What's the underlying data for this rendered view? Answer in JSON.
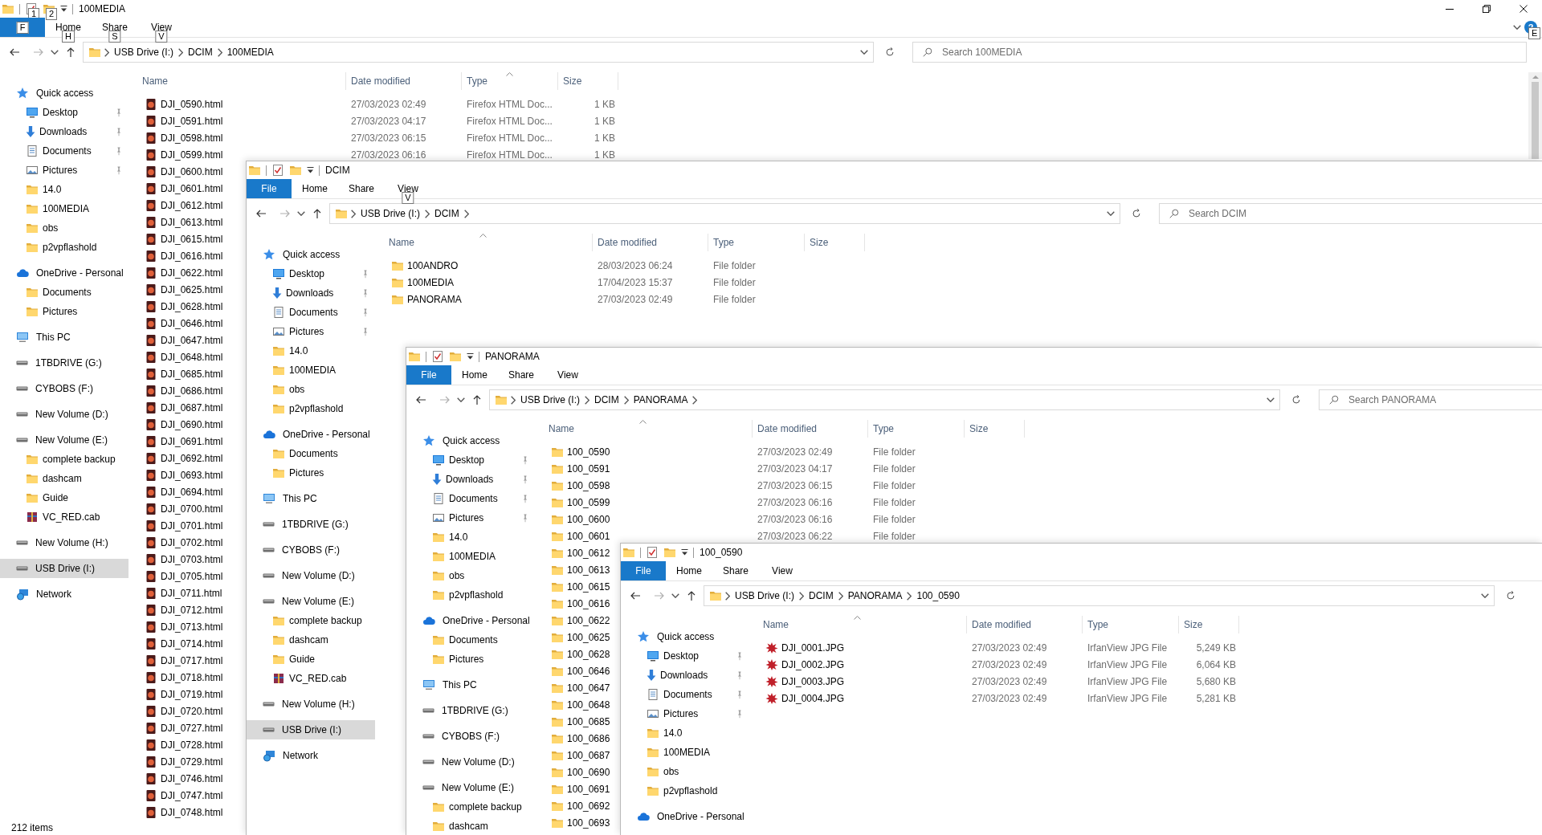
{
  "windows": [
    {
      "title": "100MEDIA",
      "window_buttons": true,
      "qat_keytips": [
        "1",
        "2"
      ],
      "help": "?",
      "help_keytip": "E",
      "tabs": [
        {
          "kind": "file",
          "keytip": "F"
        },
        {
          "kind": "tab",
          "label": "Home",
          "keytip": "H"
        },
        {
          "kind": "tab",
          "label": "Share",
          "keytip": "S"
        },
        {
          "kind": "tab",
          "label": "View",
          "keytip": "V"
        }
      ],
      "path": [
        "USB Drive (I:)",
        "DCIM",
        "100MEDIA"
      ],
      "search": {
        "placeholder": "Search 100MEDIA"
      },
      "columns": [
        {
          "label": "Name",
          "sorted": false
        },
        {
          "label": "Date modified",
          "sorted": false
        },
        {
          "label": "Type",
          "sorted": true
        },
        {
          "label": "Size",
          "sorted": false
        }
      ],
      "nav": [
        {
          "label": "Quick access",
          "kind": "star",
          "selected": false,
          "children": [
            {
              "label": "Desktop",
              "kind": "desktop",
              "pinned": true,
              "selected": false
            },
            {
              "label": "Downloads",
              "kind": "downloads",
              "pinned": true,
              "selected": false
            },
            {
              "label": "Documents",
              "kind": "documents",
              "pinned": true,
              "selected": false
            },
            {
              "label": "Pictures",
              "kind": "pictures",
              "pinned": true,
              "selected": false
            },
            {
              "label": "14.0",
              "kind": "folder",
              "pinned": false,
              "selected": false
            },
            {
              "label": "100MEDIA",
              "kind": "folder",
              "pinned": false,
              "selected": false
            },
            {
              "label": "obs",
              "kind": "folder",
              "pinned": false,
              "selected": false
            },
            {
              "label": "p2vpflashold",
              "kind": "folder",
              "pinned": false,
              "selected": false
            }
          ]
        },
        {
          "label": "OneDrive - Personal",
          "kind": "cloud",
          "selected": false,
          "children": [
            {
              "label": "Documents",
              "kind": "folder",
              "selected": false
            },
            {
              "label": "Pictures",
              "kind": "folder",
              "selected": false
            }
          ]
        },
        {
          "label": "This PC",
          "kind": "pc",
          "selected": false
        },
        {
          "label": "1TBDRIVE (G:)",
          "kind": "drive",
          "selected": false
        },
        {
          "label": "CYBOBS (F:)",
          "kind": "drive",
          "selected": false
        },
        {
          "label": "New Volume (D:)",
          "kind": "drive",
          "selected": false
        },
        {
          "label": "New Volume (E:)",
          "kind": "drive",
          "selected": false,
          "children": [
            {
              "label": "complete backup",
              "kind": "folder",
              "selected": false
            },
            {
              "label": "dashcam",
              "kind": "folder",
              "selected": false
            },
            {
              "label": "Guide",
              "kind": "folder",
              "selected": false
            },
            {
              "label": "VC_RED.cab",
              "kind": "cab",
              "selected": false
            }
          ]
        },
        {
          "label": "New Volume (H:)",
          "kind": "drive",
          "selected": false
        },
        {
          "label": "USB Drive (I:)",
          "kind": "drive",
          "selected": true
        },
        {
          "label": "Network",
          "kind": "network",
          "selected": false
        }
      ],
      "rows": [
        {
          "kind": "html",
          "name": "DJI_0590.html",
          "date": "27/03/2023 02:49",
          "type": "Firefox HTML Doc...",
          "size": "1 KB"
        },
        {
          "kind": "html",
          "name": "DJI_0591.html",
          "date": "27/03/2023 04:17",
          "type": "Firefox HTML Doc...",
          "size": "1 KB"
        },
        {
          "kind": "html",
          "name": "DJI_0598.html",
          "date": "27/03/2023 06:15",
          "type": "Firefox HTML Doc...",
          "size": "1 KB"
        },
        {
          "kind": "html",
          "name": "DJI_0599.html",
          "date": "27/03/2023 06:16",
          "type": "Firefox HTML Doc...",
          "size": "1 KB"
        },
        {
          "kind": "html",
          "name": "DJI_0600.html"
        },
        {
          "kind": "html",
          "name": "DJI_0601.html"
        },
        {
          "kind": "html",
          "name": "DJI_0612.html"
        },
        {
          "kind": "html",
          "name": "DJI_0613.html"
        },
        {
          "kind": "html",
          "name": "DJI_0615.html"
        },
        {
          "kind": "html",
          "name": "DJI_0616.html"
        },
        {
          "kind": "html",
          "name": "DJI_0622.html"
        },
        {
          "kind": "html",
          "name": "DJI_0625.html"
        },
        {
          "kind": "html",
          "name": "DJI_0628.html"
        },
        {
          "kind": "html",
          "name": "DJI_0646.html"
        },
        {
          "kind": "html",
          "name": "DJI_0647.html"
        },
        {
          "kind": "html",
          "name": "DJI_0648.html"
        },
        {
          "kind": "html",
          "name": "DJI_0685.html"
        },
        {
          "kind": "html",
          "name": "DJI_0686.html"
        },
        {
          "kind": "html",
          "name": "DJI_0687.html"
        },
        {
          "kind": "html",
          "name": "DJI_0690.html"
        },
        {
          "kind": "html",
          "name": "DJI_0691.html"
        },
        {
          "kind": "html",
          "name": "DJI_0692.html"
        },
        {
          "kind": "html",
          "name": "DJI_0693.html"
        },
        {
          "kind": "html",
          "name": "DJI_0694.html"
        },
        {
          "kind": "html",
          "name": "DJI_0700.html"
        },
        {
          "kind": "html",
          "name": "DJI_0701.html"
        },
        {
          "kind": "html",
          "name": "DJI_0702.html"
        },
        {
          "kind": "html",
          "name": "DJI_0703.html"
        },
        {
          "kind": "html",
          "name": "DJI_0705.html"
        },
        {
          "kind": "html",
          "name": "DJI_0711.html"
        },
        {
          "kind": "html",
          "name": "DJI_0712.html"
        },
        {
          "kind": "html",
          "name": "DJI_0713.html"
        },
        {
          "kind": "html",
          "name": "DJI_0714.html"
        },
        {
          "kind": "html",
          "name": "DJI_0717.html"
        },
        {
          "kind": "html",
          "name": "DJI_0718.html"
        },
        {
          "kind": "html",
          "name": "DJI_0719.html"
        },
        {
          "kind": "html",
          "name": "DJI_0720.html"
        },
        {
          "kind": "html",
          "name": "DJI_0727.html"
        },
        {
          "kind": "html",
          "name": "DJI_0728.html"
        },
        {
          "kind": "html",
          "name": "DJI_0729.html"
        },
        {
          "kind": "html",
          "name": "DJI_0746.html"
        },
        {
          "kind": "html",
          "name": "DJI_0747.html"
        },
        {
          "kind": "html",
          "name": "DJI_0748.html"
        }
      ],
      "status": "212 items"
    },
    {
      "title": "DCIM",
      "tabs": [
        {
          "kind": "file",
          "label": "File"
        },
        {
          "kind": "tab",
          "label": "Home"
        },
        {
          "kind": "tab",
          "label": "Share"
        },
        {
          "kind": "tab",
          "label": "View",
          "keytip": "V"
        }
      ],
      "path": [
        "USB Drive (I:)",
        "DCIM"
      ],
      "trailing_chevron": true,
      "search": {
        "placeholder": "Search DCIM"
      },
      "columns": [
        {
          "label": "Name",
          "sorted": true
        },
        {
          "label": "Date modified",
          "sorted": false
        },
        {
          "label": "Type",
          "sorted": false
        },
        {
          "label": "Size",
          "sorted": false
        }
      ],
      "nav": [
        {
          "label": "Quick access",
          "kind": "star",
          "selected": false,
          "children": [
            {
              "label": "Desktop",
              "kind": "desktop",
              "pinned": true,
              "selected": false
            },
            {
              "label": "Downloads",
              "kind": "downloads",
              "pinned": true,
              "selected": false
            },
            {
              "label": "Documents",
              "kind": "documents",
              "pinned": true,
              "selected": false
            },
            {
              "label": "Pictures",
              "kind": "pictures",
              "pinned": true,
              "selected": false
            },
            {
              "label": "14.0",
              "kind": "folder",
              "pinned": false,
              "selected": false
            },
            {
              "label": "100MEDIA",
              "kind": "folder",
              "pinned": false,
              "selected": false
            },
            {
              "label": "obs",
              "kind": "folder",
              "pinned": false,
              "selected": false
            },
            {
              "label": "p2vpflashold",
              "kind": "folder",
              "pinned": false,
              "selected": false
            }
          ]
        },
        {
          "label": "OneDrive - Personal",
          "kind": "cloud",
          "selected": false,
          "children": [
            {
              "label": "Documents",
              "kind": "folder",
              "selected": false
            },
            {
              "label": "Pictures",
              "kind": "folder",
              "selected": false
            }
          ]
        },
        {
          "label": "This PC",
          "kind": "pc",
          "selected": false
        },
        {
          "label": "1TBDRIVE (G:)",
          "kind": "drive",
          "selected": false
        },
        {
          "label": "CYBOBS (F:)",
          "kind": "drive",
          "selected": false
        },
        {
          "label": "New Volume (D:)",
          "kind": "drive",
          "selected": false
        },
        {
          "label": "New Volume (E:)",
          "kind": "drive",
          "selected": false,
          "children": [
            {
              "label": "complete backup",
              "kind": "folder",
              "selected": false
            },
            {
              "label": "dashcam",
              "kind": "folder",
              "selected": false
            },
            {
              "label": "Guide",
              "kind": "folder",
              "selected": false
            },
            {
              "label": "VC_RED.cab",
              "kind": "cab",
              "selected": false
            }
          ]
        },
        {
          "label": "New Volume (H:)",
          "kind": "drive",
          "selected": false
        },
        {
          "label": "USB Drive (I:)",
          "kind": "drive",
          "selected": true
        },
        {
          "label": "Network",
          "kind": "network",
          "selected": false
        }
      ],
      "rows": [
        {
          "kind": "folder",
          "name": "100ANDRO",
          "date": "28/03/2023 06:24",
          "type": "File folder"
        },
        {
          "kind": "folder",
          "name": "100MEDIA",
          "date": "17/04/2023 15:37",
          "type": "File folder"
        },
        {
          "kind": "folder",
          "name": "PANORAMA",
          "date": "27/03/2023 02:49",
          "type": "File folder"
        }
      ]
    },
    {
      "title": "PANORAMA",
      "tabs": [
        {
          "kind": "file",
          "label": "File"
        },
        {
          "kind": "tab",
          "label": "Home"
        },
        {
          "kind": "tab",
          "label": "Share"
        },
        {
          "kind": "tab",
          "label": "View"
        }
      ],
      "path": [
        "USB Drive (I:)",
        "DCIM",
        "PANORAMA"
      ],
      "trailing_chevron": true,
      "search": {
        "placeholder": "Search PANORAMA"
      },
      "columns": [
        {
          "label": "Name",
          "sorted": true
        },
        {
          "label": "Date modified",
          "sorted": false
        },
        {
          "label": "Type",
          "sorted": false
        },
        {
          "label": "Size",
          "sorted": false
        }
      ],
      "nav": [
        {
          "label": "Quick access",
          "kind": "star",
          "selected": false,
          "children": [
            {
              "label": "Desktop",
              "kind": "desktop",
              "pinned": true,
              "selected": false
            },
            {
              "label": "Downloads",
              "kind": "downloads",
              "pinned": true,
              "selected": false
            },
            {
              "label": "Documents",
              "kind": "documents",
              "pinned": true,
              "selected": false
            },
            {
              "label": "Pictures",
              "kind": "pictures",
              "pinned": true,
              "selected": false
            },
            {
              "label": "14.0",
              "kind": "folder",
              "pinned": false,
              "selected": false
            },
            {
              "label": "100MEDIA",
              "kind": "folder",
              "pinned": false,
              "selected": false
            },
            {
              "label": "obs",
              "kind": "folder",
              "pinned": false,
              "selected": false
            },
            {
              "label": "p2vpflashold",
              "kind": "folder",
              "pinned": false,
              "selected": false
            }
          ]
        },
        {
          "label": "OneDrive - Personal",
          "kind": "cloud",
          "selected": false,
          "children": [
            {
              "label": "Documents",
              "kind": "folder",
              "selected": false
            },
            {
              "label": "Pictures",
              "kind": "folder",
              "selected": false
            }
          ]
        },
        {
          "label": "This PC",
          "kind": "pc",
          "selected": false
        },
        {
          "label": "1TBDRIVE (G:)",
          "kind": "drive",
          "selected": false
        },
        {
          "label": "CYBOBS (F:)",
          "kind": "drive",
          "selected": false
        },
        {
          "label": "New Volume (D:)",
          "kind": "drive",
          "selected": false
        },
        {
          "label": "New Volume (E:)",
          "kind": "drive",
          "selected": false,
          "children": [
            {
              "label": "complete backup",
              "kind": "folder",
              "selected": false
            },
            {
              "label": "dashcam",
              "kind": "folder",
              "selected": false
            }
          ]
        }
      ],
      "rows": [
        {
          "kind": "folder",
          "name": "100_0590",
          "date": "27/03/2023 02:49",
          "type": "File folder"
        },
        {
          "kind": "folder",
          "name": "100_0591",
          "date": "27/03/2023 04:17",
          "type": "File folder"
        },
        {
          "kind": "folder",
          "name": "100_0598",
          "date": "27/03/2023 06:15",
          "type": "File folder"
        },
        {
          "kind": "folder",
          "name": "100_0599",
          "date": "27/03/2023 06:16",
          "type": "File folder"
        },
        {
          "kind": "folder",
          "name": "100_0600",
          "date": "27/03/2023 06:16",
          "type": "File folder"
        },
        {
          "kind": "folder",
          "name": "100_0601",
          "date": "27/03/2023 06:22",
          "type": "File folder"
        },
        {
          "kind": "folder",
          "name": "100_0612"
        },
        {
          "kind": "folder",
          "name": "100_0613"
        },
        {
          "kind": "folder",
          "name": "100_0615"
        },
        {
          "kind": "folder",
          "name": "100_0616"
        },
        {
          "kind": "folder",
          "name": "100_0622"
        },
        {
          "kind": "folder",
          "name": "100_0625"
        },
        {
          "kind": "folder",
          "name": "100_0628"
        },
        {
          "kind": "folder",
          "name": "100_0646"
        },
        {
          "kind": "folder",
          "name": "100_0647"
        },
        {
          "kind": "folder",
          "name": "100_0648"
        },
        {
          "kind": "folder",
          "name": "100_0685"
        },
        {
          "kind": "folder",
          "name": "100_0686"
        },
        {
          "kind": "folder",
          "name": "100_0687"
        },
        {
          "kind": "folder",
          "name": "100_0690"
        },
        {
          "kind": "folder",
          "name": "100_0691"
        },
        {
          "kind": "folder",
          "name": "100_0692"
        },
        {
          "kind": "folder",
          "name": "100_0693"
        }
      ]
    },
    {
      "title": "100_0590",
      "tabs": [
        {
          "kind": "file",
          "label": "File"
        },
        {
          "kind": "tab",
          "label": "Home"
        },
        {
          "kind": "tab",
          "label": "Share"
        },
        {
          "kind": "tab",
          "label": "View"
        }
      ],
      "path": [
        "USB Drive (I:)",
        "DCIM",
        "PANORAMA",
        "100_0590"
      ],
      "columns": [
        {
          "label": "Name",
          "sorted": true
        },
        {
          "label": "Date modified",
          "sorted": false
        },
        {
          "label": "Type",
          "sorted": false
        },
        {
          "label": "Size",
          "sorted": false
        }
      ],
      "nav": [
        {
          "label": "Quick access",
          "kind": "star",
          "selected": false,
          "children": [
            {
              "label": "Desktop",
              "kind": "desktop",
              "pinned": true,
              "selected": false
            },
            {
              "label": "Downloads",
              "kind": "downloads",
              "pinned": true,
              "selected": false
            },
            {
              "label": "Documents",
              "kind": "documents",
              "pinned": true,
              "selected": false
            },
            {
              "label": "Pictures",
              "kind": "pictures",
              "pinned": true,
              "selected": false
            },
            {
              "label": "14.0",
              "kind": "folder",
              "pinned": false,
              "selected": false
            },
            {
              "label": "100MEDIA",
              "kind": "folder",
              "pinned": false,
              "selected": false
            },
            {
              "label": "obs",
              "kind": "folder",
              "pinned": false,
              "selected": false
            },
            {
              "label": "p2vpflashold",
              "kind": "folder",
              "pinned": false,
              "selected": false
            }
          ]
        },
        {
          "label": "OneDrive - Personal",
          "kind": "cloud",
          "selected": false
        }
      ],
      "rows": [
        {
          "kind": "jpg",
          "name": "DJI_0001.JPG",
          "date": "27/03/2023 02:49",
          "type": "IrfanView JPG File",
          "size": "5,249 KB"
        },
        {
          "kind": "jpg",
          "name": "DJI_0002.JPG",
          "date": "27/03/2023 02:49",
          "type": "IrfanView JPG File",
          "size": "6,064 KB"
        },
        {
          "kind": "jpg",
          "name": "DJI_0003.JPG",
          "date": "27/03/2023 02:49",
          "type": "IrfanView JPG File",
          "size": "5,680 KB"
        },
        {
          "kind": "jpg",
          "name": "DJI_0004.JPG",
          "date": "27/03/2023 02:49",
          "type": "IrfanView JPG File",
          "size": "5,281 KB"
        }
      ]
    }
  ]
}
